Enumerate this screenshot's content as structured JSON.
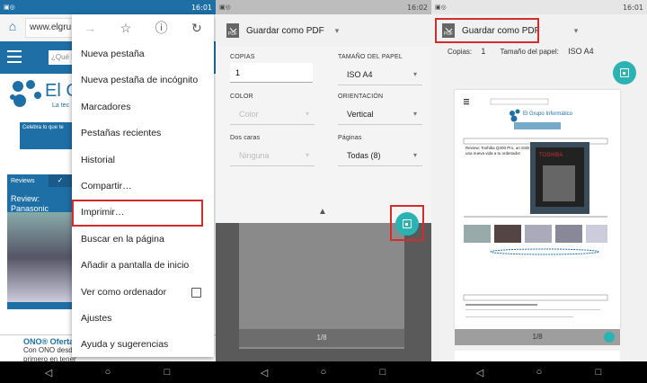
{
  "panel1": {
    "status_time": "16:01",
    "url_text": "www.elgru",
    "site_search_placeholder": "¿Qué b",
    "logo_text": "El G",
    "logo_sub": "La tec",
    "celebra_text": "Celebra lo que te",
    "reviews_label": "Reviews",
    "review_title": "Review: Panasonic seguridad y domót",
    "ad_title": "ONO® Oferta",
    "ad_line1": "Con ONO desde",
    "ad_line2": "primero en tener",
    "menu": {
      "items": [
        "Nueva pestaña",
        "Nueva pestaña de incógnito",
        "Marcadores",
        "Pestañas recientes",
        "Historial",
        "Compartir…",
        "Imprimir…",
        "Buscar en la página",
        "Añadir a pantalla de inicio",
        "Ver como ordenador",
        "Ajustes",
        "Ayuda y sugerencias"
      ]
    }
  },
  "panel2": {
    "status_time": "16:02",
    "destination": "Guardar como PDF",
    "labels": {
      "copies": "COPIAS",
      "paper_size": "TAMAÑO DEL PAPEL",
      "color": "COLOR",
      "orientation": "ORIENTACIÓN",
      "two_sided": "Dos caras",
      "pages": "Páginas"
    },
    "values": {
      "copies": "1",
      "paper_size": "ISO A4",
      "color": "Color",
      "orientation": "Vertical",
      "two_sided": "Ninguna",
      "pages": "Todas (8)"
    },
    "page_indicator": "1/8"
  },
  "panel3": {
    "status_time": "16:01",
    "destination": "Guardar como PDF",
    "copies_label": "Copias:",
    "copies_value": "1",
    "paper_label": "Tamaño del papel:",
    "paper_value": "ISO A4",
    "page_indicator": "1/8",
    "preview": {
      "logo_text": "El Grupo Informático",
      "review_title": "Review: Toshiba Q300 Pro, un SSD para una nueva vida a tu ordenador",
      "product_text": "TOSHIBA"
    }
  }
}
